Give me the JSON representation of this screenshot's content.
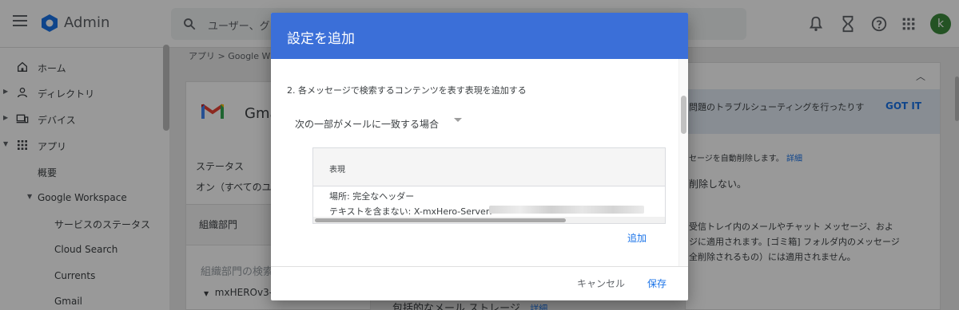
{
  "topbar": {
    "app_name": "Admin",
    "search_placeholder": "ユーザー、グ"
  },
  "sidebar": {
    "items": [
      {
        "label": "ホーム",
        "icon": "home-icon"
      },
      {
        "label": "ディレクトリ",
        "icon": "person-icon"
      },
      {
        "label": "デバイス",
        "icon": "devices-icon"
      },
      {
        "label": "アプリ",
        "icon": "apps-grid-icon"
      },
      {
        "label": "概要"
      },
      {
        "label": "Google Workspace"
      },
      {
        "label": "サービスのステータス"
      },
      {
        "label": "Cloud Search"
      },
      {
        "label": "Currents"
      },
      {
        "label": "Gmail"
      }
    ]
  },
  "main": {
    "breadcrumb": "アプリ > Google W",
    "app_title": "Gma",
    "status_label": "ステータス",
    "status_value": "オン（すべてのユ",
    "org_label": "組織部門",
    "org_search": "組織部門の検索",
    "org_item": "mxHEROv3-"
  },
  "right_panel": {
    "banner_text": "問題のトラブルシューティングを行ったりす",
    "got_it": "GOT IT",
    "line1": "セージを自動削除します。",
    "line1_link": "詳細",
    "line2": "削除しない。",
    "line3": "受信トレイ内のメールやチャット メッセージ、およ",
    "line4": "ジに適用されます。[ゴミ箱] フォルダ内のメッセージ",
    "line5": "全削除されるもの）には適用されません。"
  },
  "bottom": {
    "text": "包括的なメール ストレージ",
    "link": "詳細"
  },
  "dialog": {
    "title": "設定を追加",
    "step": "2. 各メッセージで検索するコンテンツを表す表現を追加する",
    "select_value": "次の一部がメールに一致する場合",
    "table_header": "表現",
    "row1": "場所: 完全なヘッダー",
    "row2": "テキストを含まない: X-mxHero-Server:",
    "add": "追加",
    "cancel": "キャンセル",
    "save": "保存"
  },
  "colors": {
    "accent": "#1a73e8",
    "dialog_header": "#3b6fd8",
    "avatar": "#3c8a3c"
  },
  "avatar_letter": "k"
}
